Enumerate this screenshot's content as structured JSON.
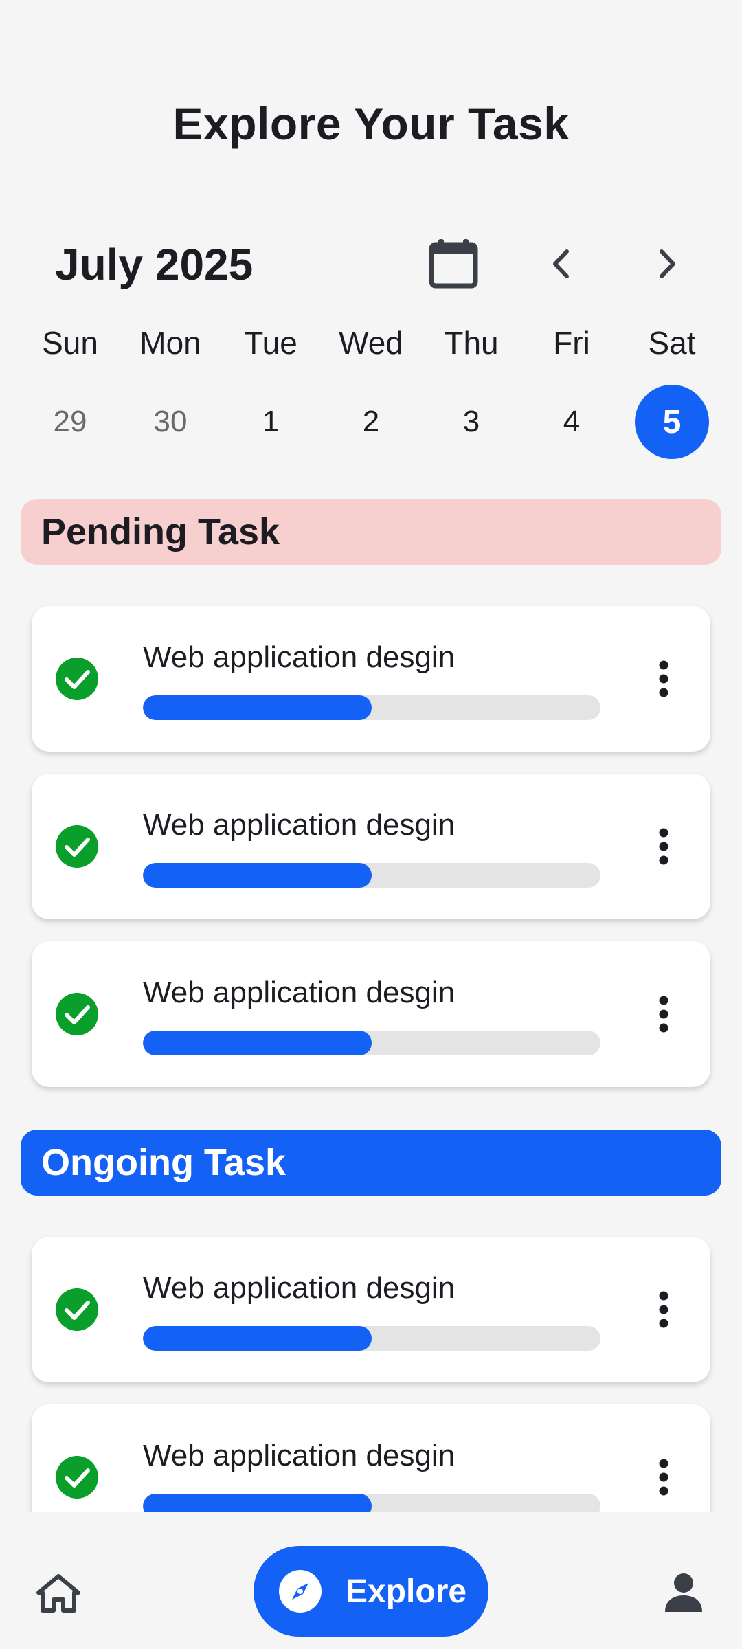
{
  "header": {
    "title": "Explore Your Task"
  },
  "calendar": {
    "month_label": "July 2025",
    "weekdays": [
      "Sun",
      "Mon",
      "Tue",
      "Wed",
      "Thu",
      "Fri",
      "Sat"
    ],
    "days": [
      "29",
      "30",
      "1",
      "2",
      "3",
      "4",
      "5"
    ],
    "selected_day": "5"
  },
  "sections": {
    "pending": {
      "label": "Pending Task",
      "tasks": [
        {
          "title": "Web application desgin",
          "progress": 0.5
        },
        {
          "title": "Web application desgin",
          "progress": 0.5
        },
        {
          "title": "Web application desgin",
          "progress": 0.5
        }
      ]
    },
    "ongoing": {
      "label": "Ongoing Task",
      "tasks": [
        {
          "title": "Web application desgin",
          "progress": 0.5
        },
        {
          "title": "Web application desgin",
          "progress": 0.5
        }
      ]
    }
  },
  "bottom_nav": {
    "home_icon": "home-icon",
    "explore_label": "Explore",
    "explore_icon": "compass-icon",
    "profile_icon": "person-icon"
  },
  "colors": {
    "accent": "#1461f5",
    "pending_bg": "#f7cfcf",
    "check_green": "#0a9e2a",
    "track_gray": "#e4e4e4"
  }
}
